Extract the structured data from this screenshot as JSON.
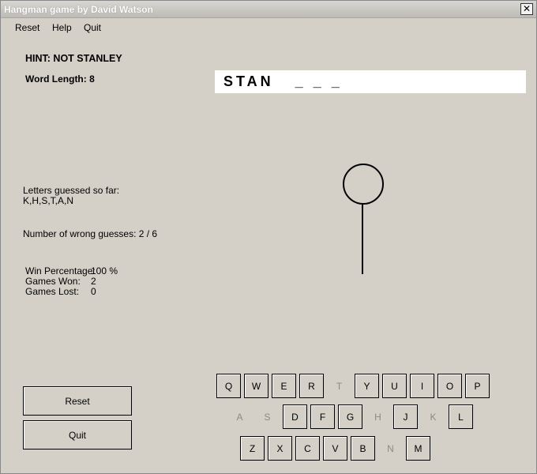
{
  "window": {
    "title": "Hangman game by David Watson",
    "close_glyph": "✕"
  },
  "menu": [
    "Reset",
    "Help",
    "Quit"
  ],
  "hint": "HINT: NOT STANLEY",
  "word_length": "Word Length: 8",
  "word_display": "STAN   _ _ _",
  "letters_guessed_label": "Letters guessed so far:",
  "letters_guessed": "K,H,S,T,A,N",
  "wrong_guesses": "Number of wrong guesses: 2 / 6",
  "stats": [
    {
      "label": "Win Percentage:",
      "value": "100 %"
    },
    {
      "label": "Games Won:",
      "value": "2"
    },
    {
      "label": "Games Lost:",
      "value": "0"
    }
  ],
  "buttons": {
    "reset": "Reset",
    "quit": "Quit"
  },
  "keyboard": {
    "row1": [
      {
        "l": "Q",
        "used": false
      },
      {
        "l": "W",
        "used": false
      },
      {
        "l": "E",
        "used": false
      },
      {
        "l": "R",
        "used": false
      },
      {
        "l": "T",
        "used": true
      },
      {
        "l": "Y",
        "used": false
      },
      {
        "l": "U",
        "used": false
      },
      {
        "l": "I",
        "used": false
      },
      {
        "l": "O",
        "used": false
      },
      {
        "l": "P",
        "used": false
      }
    ],
    "row2": [
      {
        "l": "A",
        "used": true
      },
      {
        "l": "S",
        "used": true
      },
      {
        "l": "D",
        "used": false
      },
      {
        "l": "F",
        "used": false
      },
      {
        "l": "G",
        "used": false
      },
      {
        "l": "H",
        "used": true
      },
      {
        "l": "J",
        "used": false
      },
      {
        "l": "K",
        "used": true
      },
      {
        "l": "L",
        "used": false
      }
    ],
    "row3": [
      {
        "l": "Z",
        "used": false
      },
      {
        "l": "X",
        "used": false
      },
      {
        "l": "C",
        "used": false
      },
      {
        "l": "V",
        "used": false
      },
      {
        "l": "B",
        "used": false
      },
      {
        "l": "N",
        "used": true
      },
      {
        "l": "M",
        "used": false
      }
    ]
  }
}
